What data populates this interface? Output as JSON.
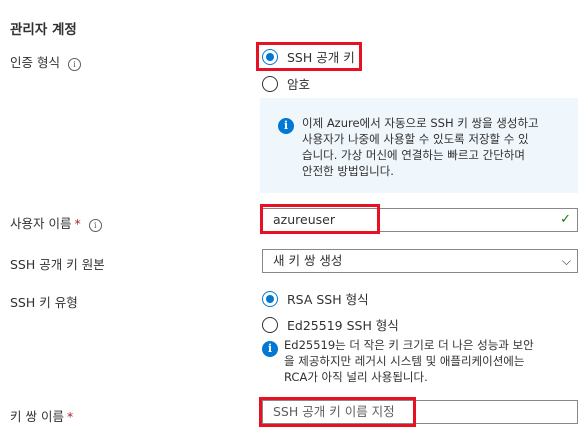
{
  "section": {
    "title": "관리자 계정"
  },
  "auth_type": {
    "label": "인증 형식",
    "info_symbol": "i",
    "options": [
      "SSH 공개 키",
      "암호"
    ],
    "selected": "SSH 공개 키"
  },
  "auth_info": {
    "icon_symbol": "i",
    "lines": [
      "이제 Azure에서 자동으로 SSH 키 쌍을 생성하고",
      "사용자가 나중에 사용할 수 있도록 저장할 수 있",
      "습니다. 가상 머신에 연결하는 빠르고 간단하며",
      "안전한 방법입니다."
    ]
  },
  "username": {
    "label": "사용자 이름",
    "required_mark": "*",
    "info_symbol": "i",
    "value": "azureuser",
    "valid_symbol": "✓"
  },
  "key_source": {
    "label": "SSH 공개 키 원본",
    "value": "새 키 쌍 생성",
    "chevron_symbol": "⌵"
  },
  "key_type": {
    "label": "SSH 키 유형",
    "options": [
      "RSA SSH 형식",
      "Ed25519 SSH 형식"
    ],
    "selected": "RSA SSH 형식"
  },
  "key_type_info": {
    "icon_symbol": "i",
    "lines": [
      "Ed25519는 더 작은 키 크기로 더 나은 성능과 보안",
      "을 제공하지만 레거시 시스템 및 애플리케이션에는",
      "RCA가 아직 널리 사용됩니다."
    ]
  },
  "key_pair_name": {
    "label": "키 쌍 이름",
    "required_mark": "*",
    "placeholder": "SSH 공개 키 이름 지정"
  },
  "colors": {
    "accent": "#0078d4",
    "highlight": "#e81123",
    "required": "#a4262c",
    "valid": "#107c10",
    "info_bg": "#eff6fc"
  }
}
